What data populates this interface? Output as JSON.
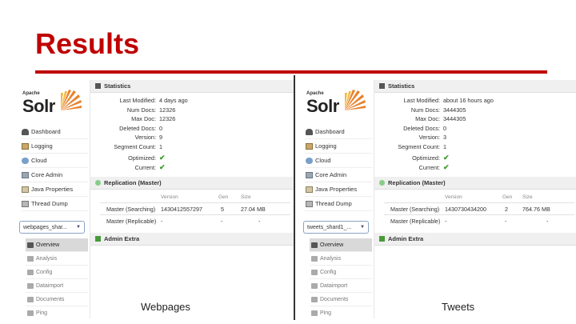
{
  "slide": {
    "title": "Results"
  },
  "panels": [
    {
      "caption": "Webpages",
      "logo": {
        "apache": "Apache",
        "solr": "Solr"
      },
      "nav": [
        "Dashboard",
        "Logging",
        "Cloud",
        "Core Admin",
        "Java Properties",
        "Thread Dump"
      ],
      "core_selector": "webpages_shar...",
      "subnav": [
        "Overview",
        "Analysis",
        "Config",
        "Dataimport",
        "Documents",
        "Ping"
      ],
      "statistics": {
        "header": "Statistics",
        "rows": [
          {
            "key": "Last Modified:",
            "value": "4 days ago"
          },
          {
            "key": "Num Docs:",
            "value": "12326"
          },
          {
            "key": "Max Doc:",
            "value": "12326"
          },
          {
            "key": "Deleted Docs:",
            "value": "0"
          },
          {
            "key": "Version:",
            "value": "9"
          },
          {
            "key": "Segment Count:",
            "value": "1"
          }
        ],
        "optimized_label": "Optimized:",
        "current_label": "Current:",
        "checkmark": "✔"
      },
      "replication": {
        "header": "Replication (Master)",
        "columns": [
          "Version",
          "Gen",
          "Size"
        ],
        "rows": [
          {
            "label": "Master (Searching)",
            "version": "1430412557297",
            "gen": "5",
            "size": "27.04 MB"
          },
          {
            "label": "Master (Replicable)",
            "version": "-",
            "gen": "-",
            "size": "-"
          }
        ]
      },
      "admin_extra": "Admin Extra"
    },
    {
      "caption": "Tweets",
      "logo": {
        "apache": "Apache",
        "solr": "Solr"
      },
      "nav": [
        "Dashboard",
        "Logging",
        "Cloud",
        "Core Admin",
        "Java Properties",
        "Thread Dump"
      ],
      "core_selector": "tweets_shard1_...",
      "subnav": [
        "Overview",
        "Analysis",
        "Config",
        "Dataimport",
        "Documents",
        "Ping"
      ],
      "statistics": {
        "header": "Statistics",
        "rows": [
          {
            "key": "Last Modified:",
            "value": "about 16 hours ago"
          },
          {
            "key": "Num Docs:",
            "value": "3444305"
          },
          {
            "key": "Max Doc:",
            "value": "3444305"
          },
          {
            "key": "Deleted Docs:",
            "value": "0"
          },
          {
            "key": "Version:",
            "value": "3"
          },
          {
            "key": "Segment Count:",
            "value": "1"
          }
        ],
        "optimized_label": "Optimized:",
        "current_label": "Current:",
        "checkmark": "✔"
      },
      "replication": {
        "header": "Replication (Master)",
        "columns": [
          "Version",
          "Gen",
          "Size"
        ],
        "rows": [
          {
            "label": "Master (Searching)",
            "version": "1430730434200",
            "gen": "2",
            "size": "764.76 MB"
          },
          {
            "label": "Master (Replicable)",
            "version": "-",
            "gen": "-",
            "size": "-"
          }
        ]
      },
      "admin_extra": "Admin Extra"
    }
  ],
  "colors": {
    "accent_red": "#c00000",
    "check_green": "#3a9a2a"
  }
}
